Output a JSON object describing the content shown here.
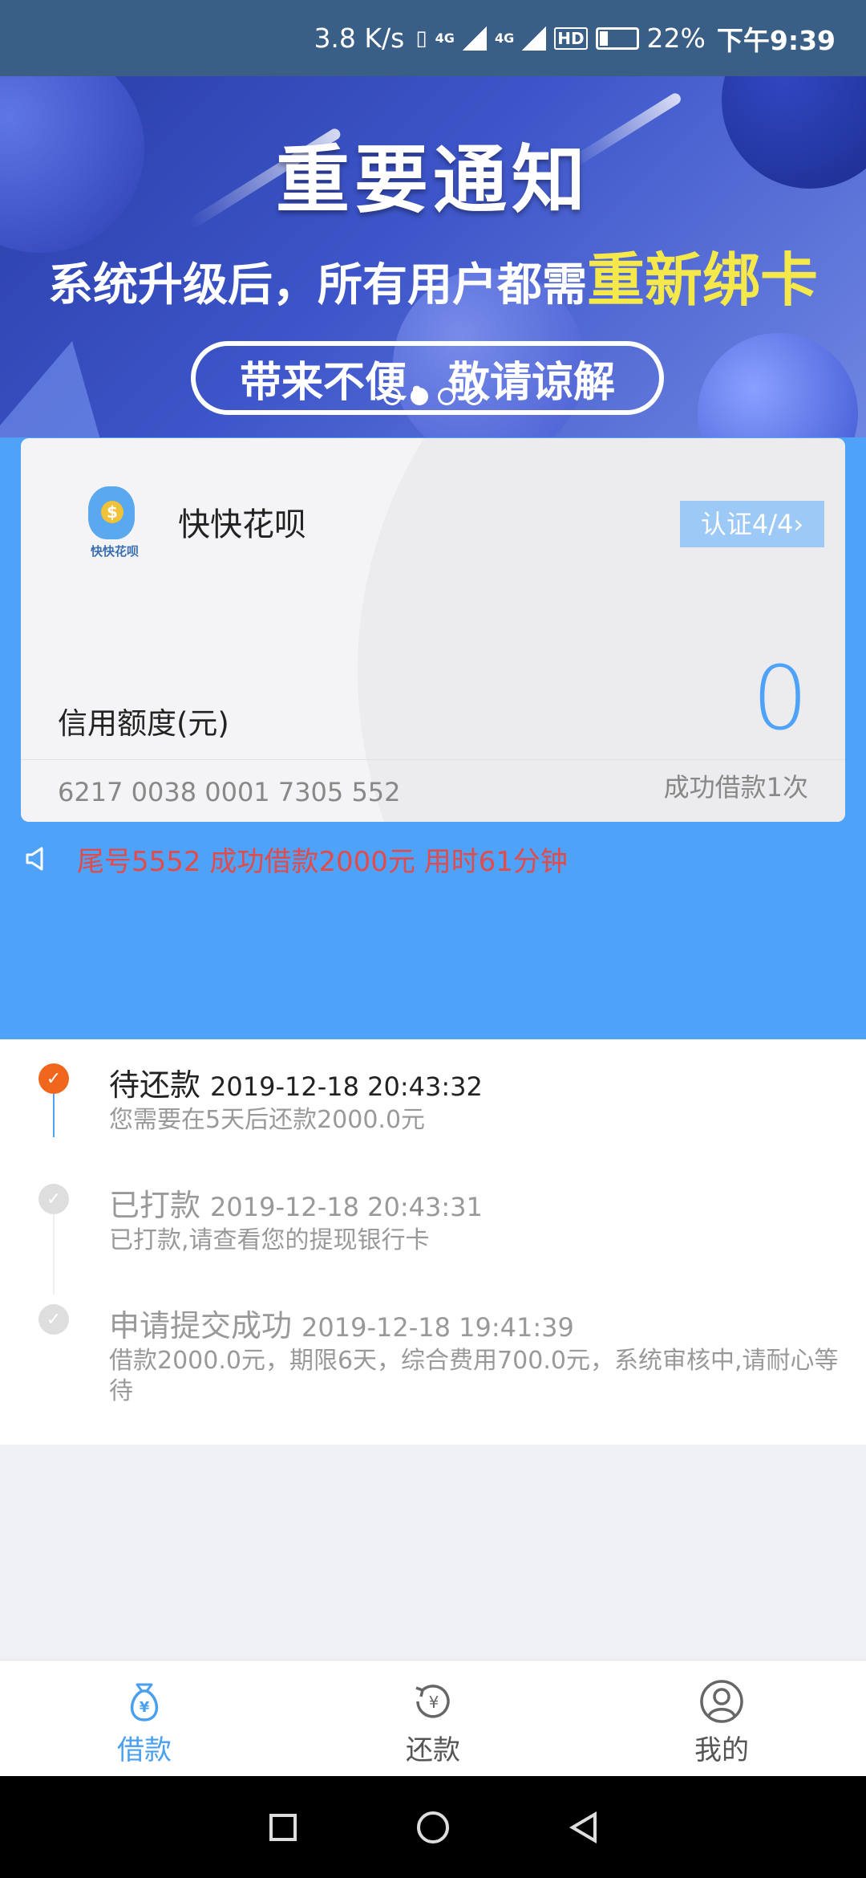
{
  "status_bar": {
    "speed": "3.8 K/s",
    "network1": "4G",
    "network2": "4G",
    "hd": "HD",
    "battery": "22%",
    "time": "下午9:39"
  },
  "banner": {
    "title": "重要通知",
    "subtitle_prefix": "系统升级后，所有用户都需",
    "subtitle_highlight": "重新绑卡",
    "pill_text": "带来不便，敬请谅解",
    "highlight_color": "#f5e84a"
  },
  "card": {
    "logo_text": "快快花呗",
    "app_name": "快快花呗",
    "auth_label": "认证4/4",
    "credit_label": "信用额度(元)",
    "credit_value": "0",
    "card_number": "6217 0038 0001 7305 552",
    "success_count": "成功借款1次"
  },
  "notice": {
    "text": "尾号5552 成功借款2000元 用时61分钟",
    "color": "#e34a4a"
  },
  "timeline": [
    {
      "status": "待还款",
      "time": "2019-12-18 20:43:32",
      "desc": "您需要在5天后还款2000.0元"
    },
    {
      "status": "已打款",
      "time": "2019-12-18 20:43:31",
      "desc": "已打款,请查看您的提现银行卡"
    },
    {
      "status": "申请提交成功",
      "time": "2019-12-18 19:41:39",
      "desc": "借款2000.0元，期限6天，综合费用700.0元，系统审核中,请耐心等待"
    }
  ],
  "tabs": [
    {
      "label": "借款",
      "icon": "money-bag-icon",
      "active": true
    },
    {
      "label": "还款",
      "icon": "repay-icon",
      "active": false
    },
    {
      "label": "我的",
      "icon": "user-icon",
      "active": false
    }
  ],
  "colors": {
    "primary_blue": "#4ea2f7",
    "active_dot": "#f0661c"
  }
}
